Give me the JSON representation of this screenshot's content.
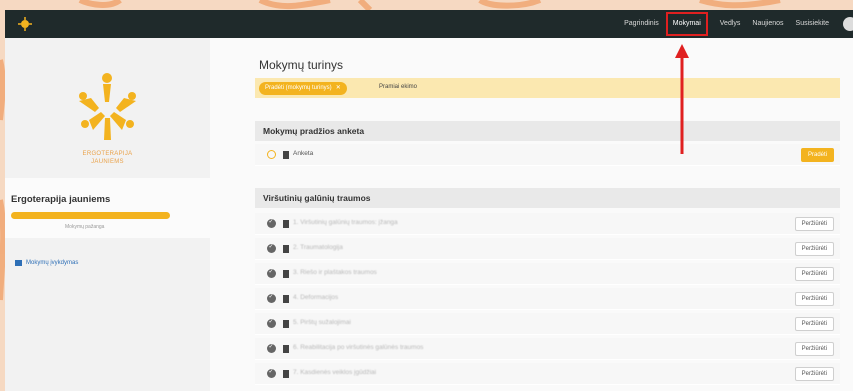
{
  "topbar": {
    "nav": [
      "Pagrindinis",
      "Mokymai",
      "Vedlys",
      "Naujienos",
      "Susisiekite"
    ],
    "active_index": 1
  },
  "sidebar": {
    "logo_text_line1": "ERGOTERAPIJA",
    "logo_text_line2": "JAUNIEMS",
    "course_title": "Ergoterapija jauniems",
    "progress_text": "Mokymų pažanga",
    "link_label": "Mokymų įvykdymas"
  },
  "main": {
    "title": "Mokymų turinys",
    "filter_chip": "Pradėti (mokymų turinys)",
    "filter_text": "Pramiai ekimo",
    "sections": [
      {
        "title": "Mokymų pradžios anketa",
        "rows": [
          {
            "label": "Anketa",
            "status": "pending",
            "button": "Pradėti",
            "primary": true,
            "blurred": false
          }
        ]
      },
      {
        "title": "Viršutinių galūnių traumos",
        "rows": [
          {
            "label": "1. Viršutinių galūnių traumos: įžanga",
            "status": "done",
            "button": "Peržiūrėti",
            "primary": false,
            "blurred": true
          },
          {
            "label": "2. Traumatologija",
            "status": "done",
            "button": "Peržiūrėti",
            "primary": false,
            "blurred": true
          },
          {
            "label": "3. Riešo ir plaštakos traumos",
            "status": "done",
            "button": "Peržiūrėti",
            "primary": false,
            "blurred": true
          },
          {
            "label": "4. Deformacijos",
            "status": "done",
            "button": "Peržiūrėti",
            "primary": false,
            "blurred": true
          },
          {
            "label": "5. Pirštų sužalojimai",
            "status": "done",
            "button": "Peržiūrėti",
            "primary": false,
            "blurred": true
          },
          {
            "label": "6. Reabilitacija po viršutinės galūnės traumos",
            "status": "done",
            "button": "Peržiūrėti",
            "primary": false,
            "blurred": true
          },
          {
            "label": "7. Kasdienės veiklos įgūdžiai",
            "status": "done",
            "button": "Peržiūrėti",
            "primary": false,
            "blurred": true
          }
        ]
      }
    ]
  },
  "colors": {
    "accent": "#f3b31f",
    "topbar": "#1f2a2b",
    "annotation": "#e02020"
  }
}
